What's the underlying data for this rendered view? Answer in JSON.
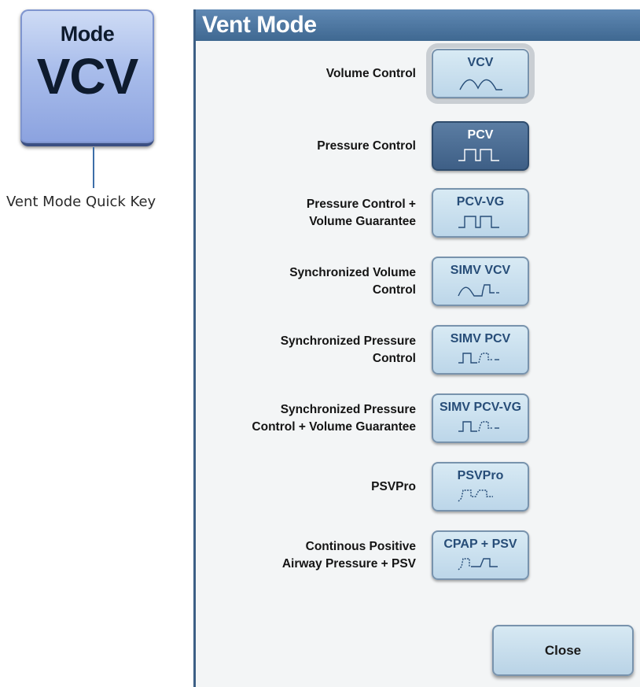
{
  "quick_key": {
    "label": "Mode",
    "value": "VCV",
    "caption": "Vent Mode Quick Key"
  },
  "dialog": {
    "title": "Vent Mode",
    "close_label": "Close"
  },
  "modes": [
    {
      "label_lines": [
        "Volume Control"
      ],
      "button": "VCV",
      "waveform": "volume-wave-icon",
      "state": "focused"
    },
    {
      "label_lines": [
        "Pressure Control"
      ],
      "button": "PCV",
      "waveform": "pressure-wave-icon",
      "state": "active"
    },
    {
      "label_lines": [
        "Pressure Control +",
        "Volume Guarantee"
      ],
      "button": "PCV-VG",
      "waveform": "pressure-wave-icon",
      "state": "normal"
    },
    {
      "label_lines": [
        "Synchronized Volume",
        "Control"
      ],
      "button": "SIMV VCV",
      "waveform": "simv-volume-wave-icon",
      "state": "normal"
    },
    {
      "label_lines": [
        "Synchronized Pressure",
        "Control"
      ],
      "button": "SIMV PCV",
      "waveform": "simv-pressure-wave-icon",
      "state": "normal"
    },
    {
      "label_lines": [
        "Synchronized Pressure",
        "Control + Volume Guarantee"
      ],
      "button": "SIMV PCV-VG",
      "waveform": "simv-pressure-wave-icon",
      "state": "normal"
    },
    {
      "label_lines": [
        "PSVPro"
      ],
      "button": "PSVPro",
      "waveform": "psv-wave-icon",
      "state": "normal"
    },
    {
      "label_lines": [
        "Continous Positive",
        "Airway Pressure + PSV"
      ],
      "button": "CPAP + PSV",
      "waveform": "cpap-wave-icon",
      "state": "normal"
    }
  ],
  "colors": {
    "header": "#3f6891",
    "button_text": "#274d78",
    "active_button": "#3e5f86"
  }
}
